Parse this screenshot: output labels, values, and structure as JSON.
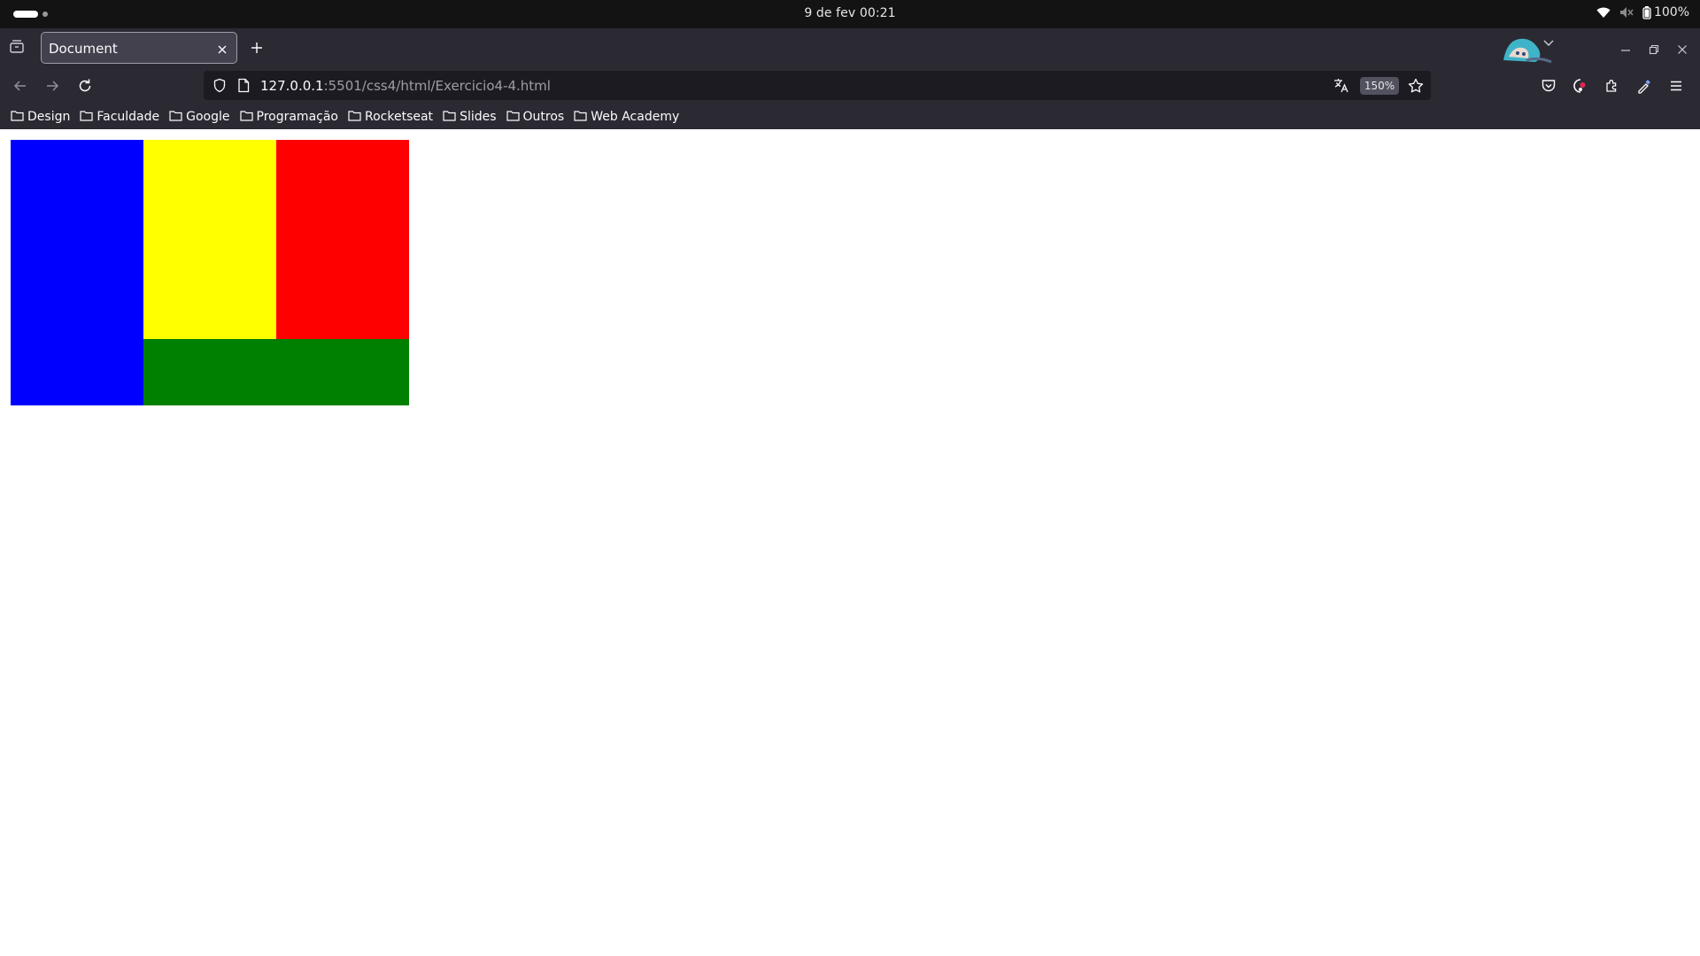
{
  "system_bar": {
    "clock": "9 de fev  00:21",
    "battery": "100%"
  },
  "browser": {
    "tab": {
      "title": "Document"
    },
    "url": {
      "host": "127.0.0.1",
      "rest": ":5501/css4/html/Exercicio4-4.html"
    },
    "zoom": "150%",
    "bookmarks": [
      "Design",
      "Faculdade",
      "Google",
      "Programação",
      "Rocketseat",
      "Slides",
      "Outros",
      "Web Academy"
    ]
  },
  "page": {
    "boxes": [
      {
        "name": "blue-box",
        "color": "#0000ff"
      },
      {
        "name": "yellow-box",
        "color": "#ffff00"
      },
      {
        "name": "red-box",
        "color": "#ff0000"
      },
      {
        "name": "green-box",
        "color": "#008000"
      }
    ]
  }
}
